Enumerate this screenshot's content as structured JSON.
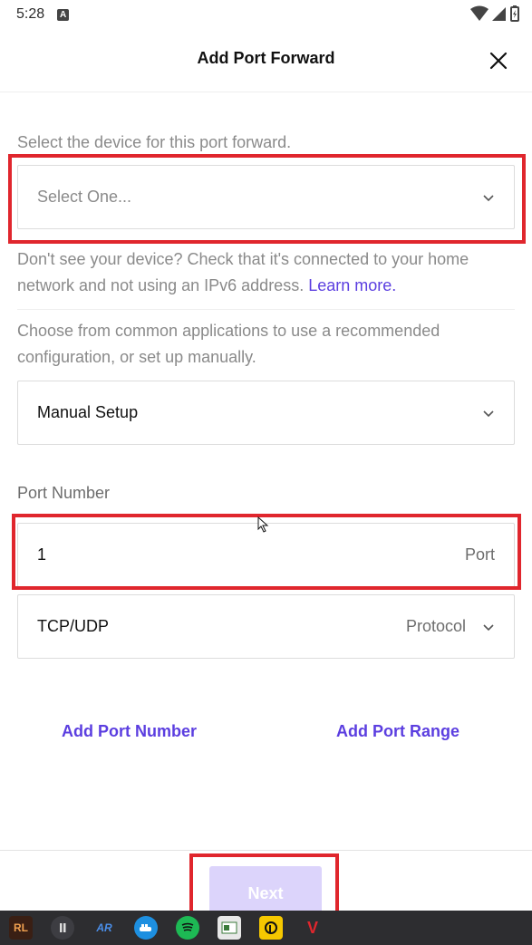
{
  "status_bar": {
    "time": "5:28",
    "notif_badge": "A"
  },
  "header": {
    "title": "Add Port Forward"
  },
  "device": {
    "label": "Select the device for this port forward.",
    "placeholder": "Select One...",
    "help_text": "Don't see your device? Check that it's connected to your home network and not using an IPv6 address.",
    "help_link": "Learn more."
  },
  "application": {
    "label": "Choose from common applications to use a recommended configuration, or set up manually.",
    "selected": "Manual Setup"
  },
  "port": {
    "label": "Port Number",
    "value": "1",
    "suffix": "Port"
  },
  "protocol": {
    "value": "TCP/UDP",
    "suffix": "Protocol"
  },
  "actions": {
    "add_port_number": "Add Port Number",
    "add_port_range": "Add Port Range"
  },
  "footer": {
    "next_label": "Next"
  },
  "colors": {
    "accent": "#5b3ee0",
    "highlight": "#e0262d",
    "next_disabled": "#dcd4fb"
  },
  "taskbar": {
    "icons": [
      "rl-icon",
      "audio-icon",
      "ar-icon",
      "docker-icon",
      "spotify-icon",
      "notes-icon",
      "pockity-icon",
      "vivaldi-icon"
    ]
  }
}
